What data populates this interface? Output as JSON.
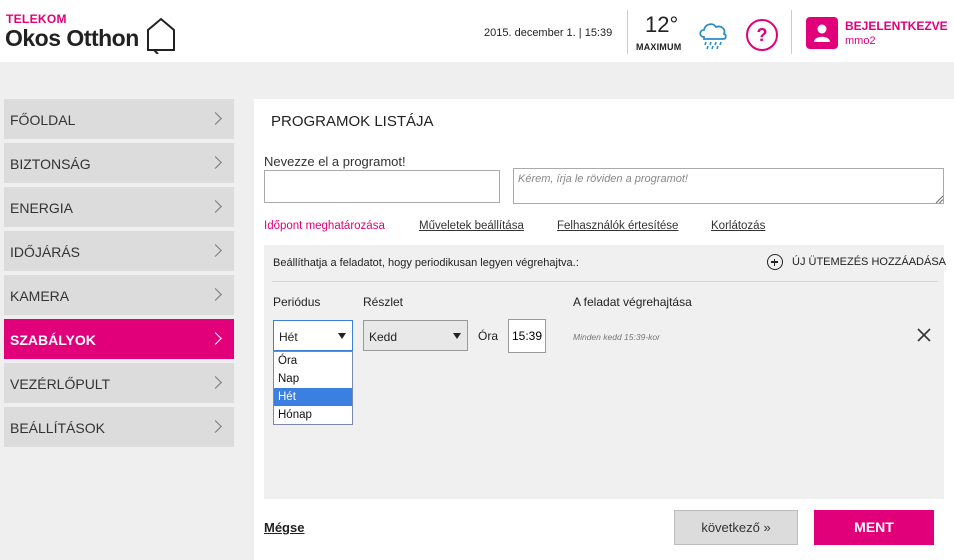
{
  "header": {
    "brand_small": "TELEKOM",
    "brand_big": "Okos Otthon",
    "datetime": "2015. december 1. | 15:39",
    "temperature": "12°",
    "temperature_label": "MAXIMUM",
    "help_symbol": "?",
    "user_status": "BEJELENTKEZVE",
    "user_name": "mmo2",
    "icons": [
      "house-logo-icon",
      "rain-cloud-icon",
      "help-icon",
      "user-icon"
    ],
    "accent_color": "#e2007a"
  },
  "sidebar": {
    "items": [
      {
        "label": "FŐOLDAL",
        "active": false
      },
      {
        "label": "BIZTONSÁG",
        "active": false
      },
      {
        "label": "ENERGIA",
        "active": false
      },
      {
        "label": "IDŐJÁRÁS",
        "active": false
      },
      {
        "label": "KAMERA",
        "active": false
      },
      {
        "label": "SZABÁLYOK",
        "active": true
      },
      {
        "label": "VEZÉRLŐPULT",
        "active": false
      },
      {
        "label": "BEÁLLÍTÁSOK",
        "active": false
      }
    ]
  },
  "main": {
    "title": "PROGRAMOK LISTÁJA",
    "name_label": "Nevezze el a programot!",
    "name_value": "",
    "desc_placeholder": "Kérem, írja le röviden a programot!",
    "tabs": [
      {
        "label": "Időpont meghatározása",
        "active": true
      },
      {
        "label": "Műveletek beállítása",
        "active": false
      },
      {
        "label": "Felhasználók értesítése",
        "active": false
      },
      {
        "label": "Korlátozás",
        "active": false
      }
    ],
    "schedule": {
      "description": "Beállíthatja a feladatot, hogy periodikusan legyen végrehajtva.:",
      "add_label": "ÚJ ÜTEMEZÉS HOZZÁADÁSA",
      "col_period": "Periódus",
      "col_detail": "Részlet",
      "col_exec": "A feladat végrehajtása",
      "period_value": "Hét",
      "detail_value": "Kedd",
      "time_label": "Óra",
      "time_value": "15:39",
      "exec_text": "Minden kedd 15:39-kor",
      "period_options": [
        "Óra",
        "Nap",
        "Hét",
        "Hónap"
      ],
      "period_selected_index": 2
    },
    "cancel_label": "Mégse",
    "next_label": "következő »",
    "save_label": "MENT"
  }
}
